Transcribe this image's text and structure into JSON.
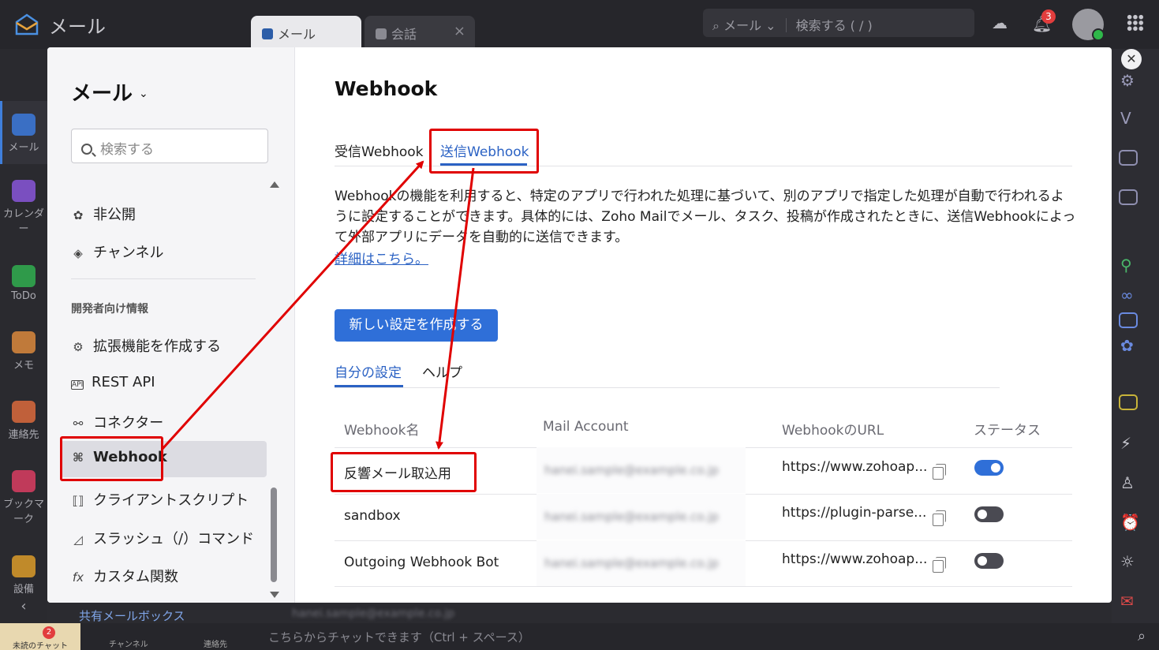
{
  "app": {
    "title": "メール"
  },
  "topbar": {
    "tabs": [
      {
        "label": "メール",
        "active": true
      },
      {
        "label": "会話",
        "active": false
      }
    ],
    "search_scope": "メール",
    "search_placeholder": "検索する ( / )",
    "notification_count": "3"
  },
  "leftbar": {
    "items": [
      {
        "label": "メール",
        "icon": "mail-icon",
        "color": "#3a6fc4"
      },
      {
        "label": "カレンダー",
        "icon": "calendar-icon",
        "color": "#7a4fc0"
      },
      {
        "label": "ToDo",
        "icon": "todo-icon",
        "color": "#2f9a4a"
      },
      {
        "label": "メモ",
        "icon": "memo-icon",
        "color": "#c07a3a"
      },
      {
        "label": "連絡先",
        "icon": "contacts-icon",
        "color": "#c0603a"
      },
      {
        "label": "ブックマーク",
        "icon": "bookmark-icon",
        "color": "#c03a5a"
      },
      {
        "label": "設備",
        "icon": "equipment-icon",
        "color": "#c08a2a"
      }
    ]
  },
  "background": {
    "shared_mailbox": "共有メールボックス"
  },
  "bottombar": {
    "unread_chat": "未読のチャット",
    "unread_count": "2",
    "channels": "チャンネル",
    "contacts": "連絡先",
    "chat_placeholder": "こちらからチャットできます（Ctrl + スペース）"
  },
  "sidebar": {
    "title": "メール",
    "search_placeholder": "検索する",
    "items_top": [
      {
        "label": "非公開",
        "icon": "private-icon"
      },
      {
        "label": "チャンネル",
        "icon": "channel-icon"
      }
    ],
    "section_title": "開発者向け情報",
    "dev_items": [
      {
        "label": "拡張機能を作成する",
        "icon": "extension-icon"
      },
      {
        "label": "REST API",
        "icon": "api-icon"
      },
      {
        "label": "コネクター",
        "icon": "connector-icon"
      },
      {
        "label": "Webhook",
        "icon": "webhook-icon",
        "selected": true
      },
      {
        "label": "クライアントスクリプト",
        "icon": "client-script-icon"
      },
      {
        "label": "スラッシュ（/）コマンド",
        "icon": "slash-command-icon"
      },
      {
        "label": "カスタム関数",
        "icon": "custom-function-icon"
      }
    ]
  },
  "main": {
    "title": "Webhook",
    "tabs": [
      {
        "label": "受信Webhook",
        "active": false
      },
      {
        "label": "送信Webhook",
        "active": true
      }
    ],
    "description": "Webhookの機能を利用すると、特定のアプリで行われた処理に基づいて、別のアプリで指定した処理が自動で行われるように設定することができます。具体的には、Zoho Mailでメール、タスク、投稿が作成されたときに、送信Webhookによって外部アプリにデータを自動的に送信できます。",
    "learn_more": "詳細はこちら。",
    "new_button": "新しい設定を作成する",
    "subtabs": [
      {
        "label": "自分の設定",
        "active": true
      },
      {
        "label": "ヘルプ",
        "active": false
      }
    ],
    "table": {
      "headers": [
        "Webhook名",
        "Mail Account",
        "WebhookのURL",
        "ステータス"
      ],
      "rows": [
        {
          "name": "反響メール取込用",
          "account": "hanei.sample@example.co.jp",
          "url": "https://www.zohoap...",
          "status": "on"
        },
        {
          "name": "sandbox",
          "account": "hanei.sample@example.co.jp",
          "url": "https://plugin-parse...",
          "status": "off"
        },
        {
          "name": "Outgoing Webhook Bot",
          "account": "hanei.sample@example.co.jp",
          "url": "https://www.zohoap...",
          "status": "off"
        }
      ]
    }
  },
  "colors": {
    "accent": "#2f6fd8",
    "annotation": "#e00000"
  }
}
